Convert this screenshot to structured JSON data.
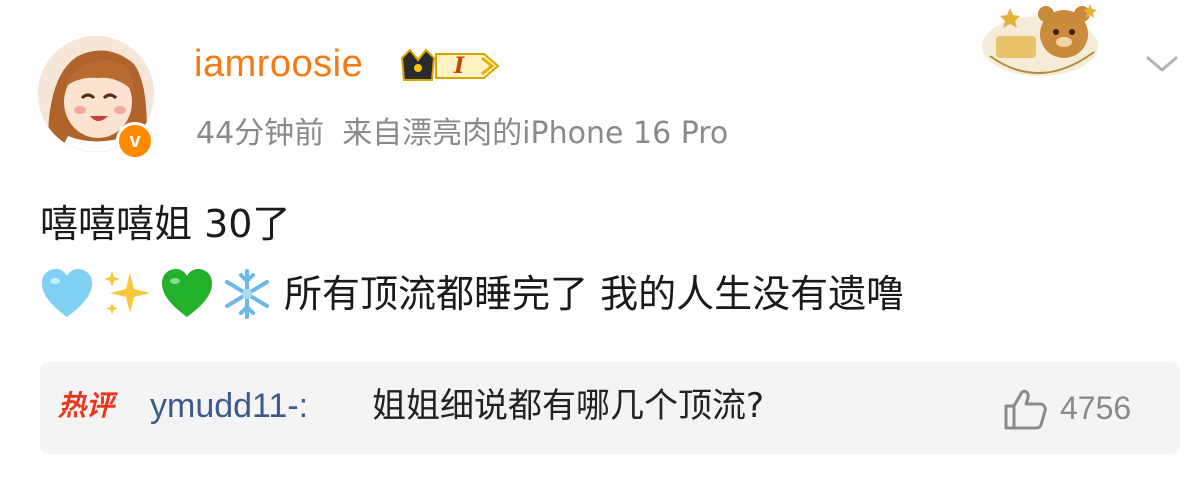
{
  "post": {
    "username": "iamroosie",
    "level_label": "I",
    "time": "44分钟前",
    "source": "来自漂亮肉的iPhone 16 Pro",
    "verified_label": "v",
    "line1": "嘻嘻嘻姐 30了",
    "line2_text": "所有顶流都睡完了 我的人生没有遗噜",
    "emojis": [
      "light-blue-heart",
      "sparkles",
      "green-heart",
      "snowflake"
    ]
  },
  "hot_comment": {
    "tag": "热评",
    "user": "ymudd11-:",
    "text": "姐姐细说都有哪几个顶流?",
    "likes": "4756"
  },
  "colors": {
    "username": "#f57a14",
    "comment_user": "#3c5b8a",
    "hot_tag": "#e8361f",
    "meta": "#8a8a8a"
  }
}
